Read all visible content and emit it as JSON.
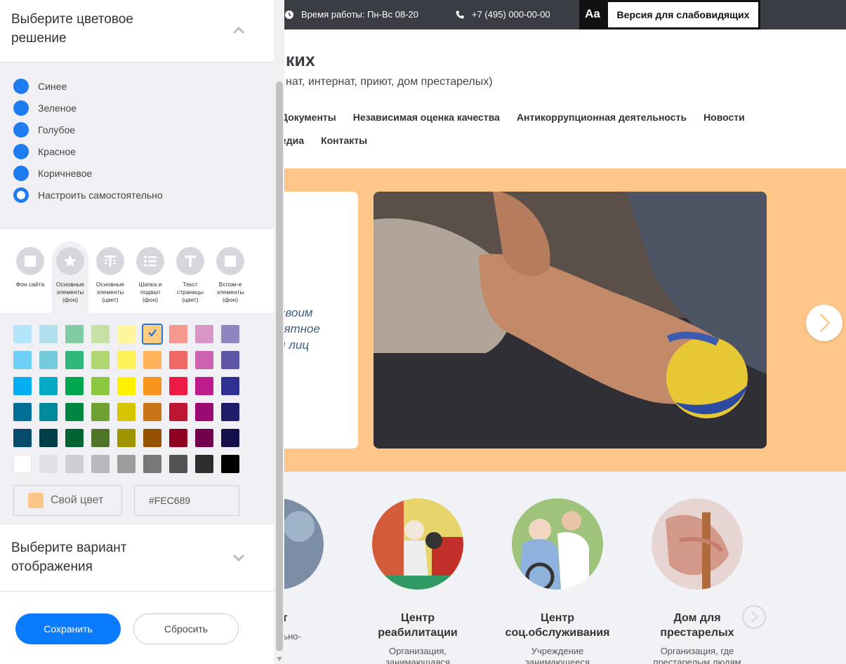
{
  "topbar": {
    "hours": "Время работы: Пн-Вс 08-20",
    "phone": "+7 (495) 000-00-00",
    "vi_icon": "Aa",
    "vi_label": "Версия для слабовидящих"
  },
  "header": {
    "title": "ких",
    "subtitle": "нат, интернат, приют, дом престарелых)",
    "nav_row1": [
      "Документы",
      "Независимая оценка качества",
      "Антикоррупционная деятельность",
      "Новости"
    ],
    "nav_row2": [
      "едиа",
      "Контакты"
    ]
  },
  "hero": {
    "text_lines": [
      "своим",
      "иятное",
      "м лиц"
    ]
  },
  "services": [
    {
      "name_lines": [
        "от",
        ""
      ],
      "desc_lines": [
        "тельно-",
        ""
      ]
    },
    {
      "name_lines": [
        "Центр",
        "реабилитации"
      ],
      "desc_lines": [
        "Организация,",
        "занимающаяся"
      ]
    },
    {
      "name_lines": [
        "Центр",
        "соц.обслуживания"
      ],
      "desc_lines": [
        "Учреждение",
        "занимающееся"
      ]
    },
    {
      "name_lines": [
        "Дом для",
        "престарелых"
      ],
      "desc_lines": [
        "Организация, где",
        "престарелым людям"
      ]
    }
  ],
  "panel": {
    "color_section_title": "Выберите цветовое решение",
    "schemes": [
      {
        "label": "Синее",
        "selected": false
      },
      {
        "label": "Зеленое",
        "selected": false
      },
      {
        "label": "Голубое",
        "selected": false
      },
      {
        "label": "Красное",
        "selected": false
      },
      {
        "label": "Коричневое",
        "selected": false
      },
      {
        "label": "Настроить самостоятельно",
        "selected": true
      }
    ],
    "tabs": [
      {
        "label": "Фон сайта",
        "icon": "square-icon",
        "active": false
      },
      {
        "label": "Основные элементы (фон)",
        "icon": "star-icon",
        "active": true
      },
      {
        "label": "Основные элементы (цвет)",
        "icon": "text-columns-icon",
        "active": false
      },
      {
        "label": "Шапка и подвал (фон)",
        "icon": "list-icon",
        "active": false
      },
      {
        "label": "Текст страницы (цвет)",
        "icon": "text-t-icon",
        "active": false
      },
      {
        "label": "Вспом-е элементы (фон)",
        "icon": "square-icon",
        "active": false
      }
    ],
    "palette": [
      [
        "#b3e5fb",
        "#b2dfee",
        "#80cba4",
        "#c5e1a5",
        "#fff59d",
        "#ffcc80",
        "#f4998d",
        "#d896c7",
        "#8d86c0"
      ],
      [
        "#6fd0f7",
        "#74cbd9",
        "#2eb87a",
        "#aed673",
        "#fff158",
        "#ffb35a",
        "#f06863",
        "#cc62b0",
        "#5e55a8"
      ],
      [
        "#05aef0",
        "#04a9c4",
        "#00a650",
        "#8dc63f",
        "#fff100",
        "#f7941d",
        "#ee1c44",
        "#bd1c8c",
        "#2e3192"
      ],
      [
        "#026f97",
        "#018a99",
        "#008641",
        "#6fa030",
        "#d6c400",
        "#c87417",
        "#bd1632",
        "#9b0a72",
        "#1f1c6a"
      ],
      [
        "#044b6c",
        "#003f4a",
        "#006432",
        "#4e7527",
        "#9e9500",
        "#955205",
        "#8f0121",
        "#72004d",
        "#140f4a"
      ],
      [
        "#ffffff",
        "#e2e2e6",
        "#cfcfd3",
        "#b9b9bd",
        "#9c9c9f",
        "#78787b",
        "#525254",
        "#2d2d2e",
        "#000000"
      ]
    ],
    "selected_swatch": {
      "row": 0,
      "col": 5
    },
    "own_color_label": "Свой цвет",
    "own_color_value": "#FEC689",
    "own_color_hex": "#FEC689",
    "display_section_title": "Выберите вариант отображения",
    "save_label": "Сохранить",
    "reset_label": "Сбросить"
  },
  "colors": {
    "accent": "#0a7bff",
    "radio": "#1e7bf0",
    "hero_bg": "#fec689",
    "topbar": "#3a3d44"
  }
}
